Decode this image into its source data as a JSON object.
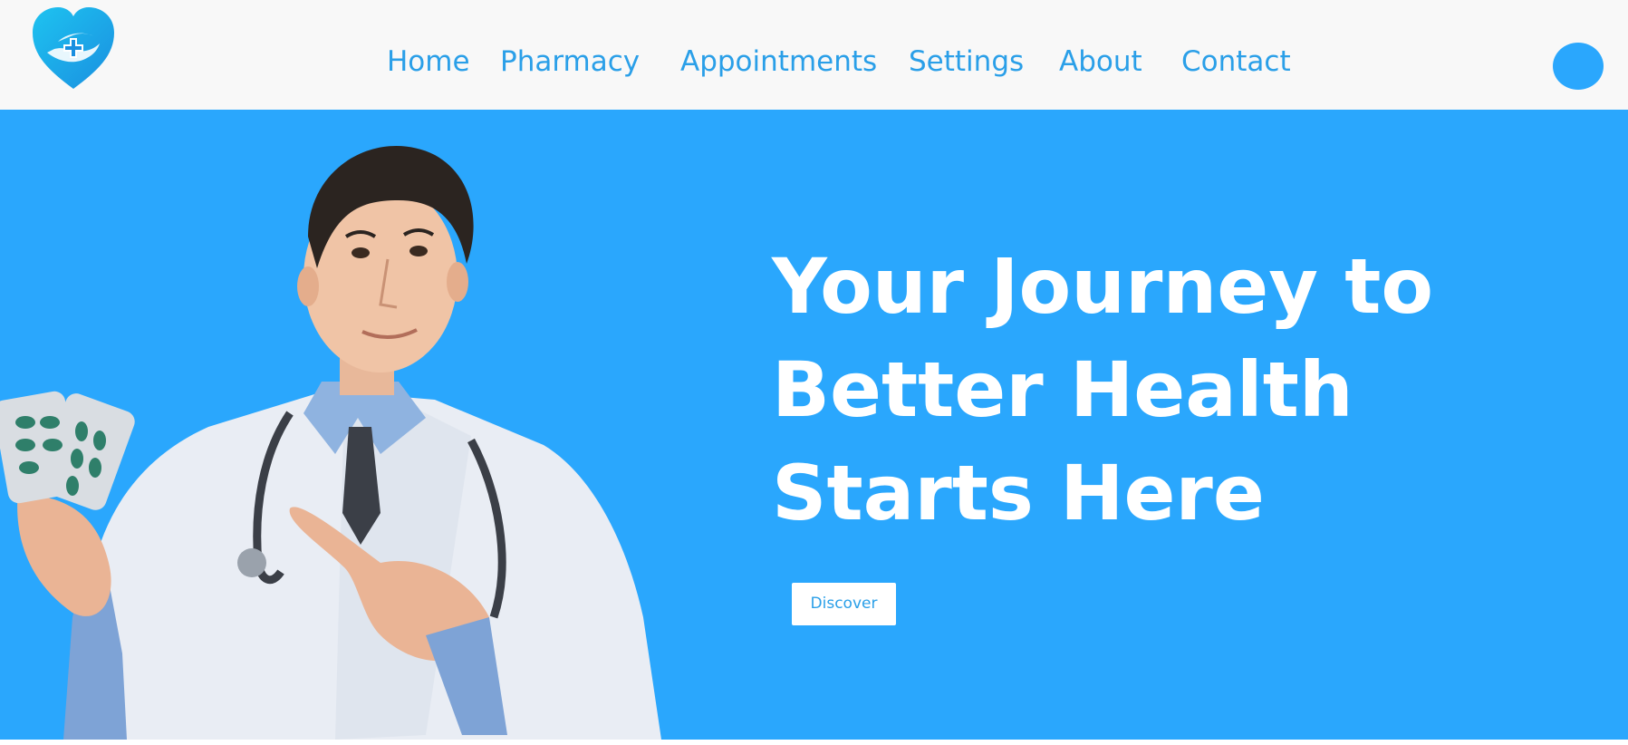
{
  "nav": {
    "logo_icon": "heart-hands-medical-cross-icon",
    "links": [
      {
        "label": "Home"
      },
      {
        "label": "Pharmacy"
      },
      {
        "label": "Appointments"
      },
      {
        "label": "Settings"
      },
      {
        "label": "About"
      },
      {
        "label": "Contact"
      }
    ],
    "profile_icon": "user-avatar-circle"
  },
  "hero": {
    "headline_lines": [
      "Your Journey to",
      "Better Health",
      "Starts Here"
    ],
    "cta_label": "Discover",
    "image_subject": "doctor-with-pills-photo"
  },
  "colors": {
    "brand_blue": "#2aa7fd",
    "nav_text": "#2a9fe8",
    "nav_background": "#f8f8f8",
    "headline_text": "#ffffff"
  }
}
